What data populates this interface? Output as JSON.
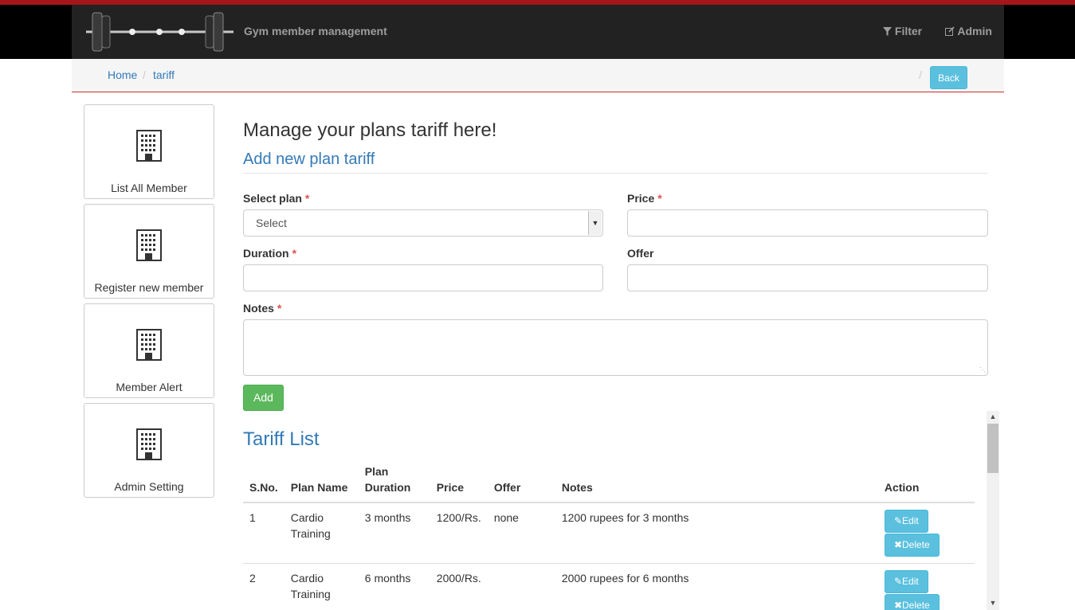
{
  "header": {
    "brand": "Gym member management",
    "filter_label": "Filter",
    "admin_label": "Admin"
  },
  "breadcrumb": {
    "home": "Home",
    "separator": "/",
    "current": "tariff",
    "back_label": "Back"
  },
  "sidebar": {
    "items": [
      {
        "label": "List All Member",
        "icon": "building-icon"
      },
      {
        "label": "Register new member",
        "icon": "building-icon"
      },
      {
        "label": "Member Alert",
        "icon": "building-icon"
      },
      {
        "label": "Admin Setting",
        "icon": "building-icon"
      }
    ]
  },
  "main": {
    "title": "Manage your plans tariff here!",
    "subtitle": "Add new plan tariff",
    "required_mark": "*"
  },
  "form": {
    "plan_label": "Select plan",
    "plan_value": "Select",
    "price_label": "Price",
    "price_value": "",
    "duration_label": "Duration",
    "duration_value": "",
    "offer_label": "Offer",
    "offer_value": "",
    "notes_label": "Notes",
    "notes_value": "",
    "add_label": "Add"
  },
  "tariff": {
    "title": "Tariff List",
    "headers": {
      "sno": "S.No.",
      "plan_name": "Plan Name",
      "plan_duration_1": "Plan",
      "plan_duration_2": "Duration",
      "price": "Price",
      "offer": "Offer",
      "notes": "Notes",
      "action": "Action"
    },
    "rows": [
      {
        "sno": "1",
        "plan_1": "Cardio",
        "plan_2": "Training",
        "duration": "3 months",
        "price": "1200/Rs.",
        "offer": "none",
        "notes": "1200 rupees for 3 months",
        "edit": "Edit",
        "delete": "Delete"
      },
      {
        "sno": "2",
        "plan_1": "Cardio",
        "plan_2": "Training",
        "duration": "6 months",
        "price": "2000/Rs.",
        "offer": "",
        "notes": "2000 rupees for 6 months",
        "edit": "Edit",
        "delete": "Delete"
      }
    ]
  },
  "colors": {
    "accent_red": "#a4161a",
    "link_blue": "#337ab7",
    "info_blue": "#5bc0de",
    "success_green": "#5cb85c",
    "navbar": "#222222"
  }
}
